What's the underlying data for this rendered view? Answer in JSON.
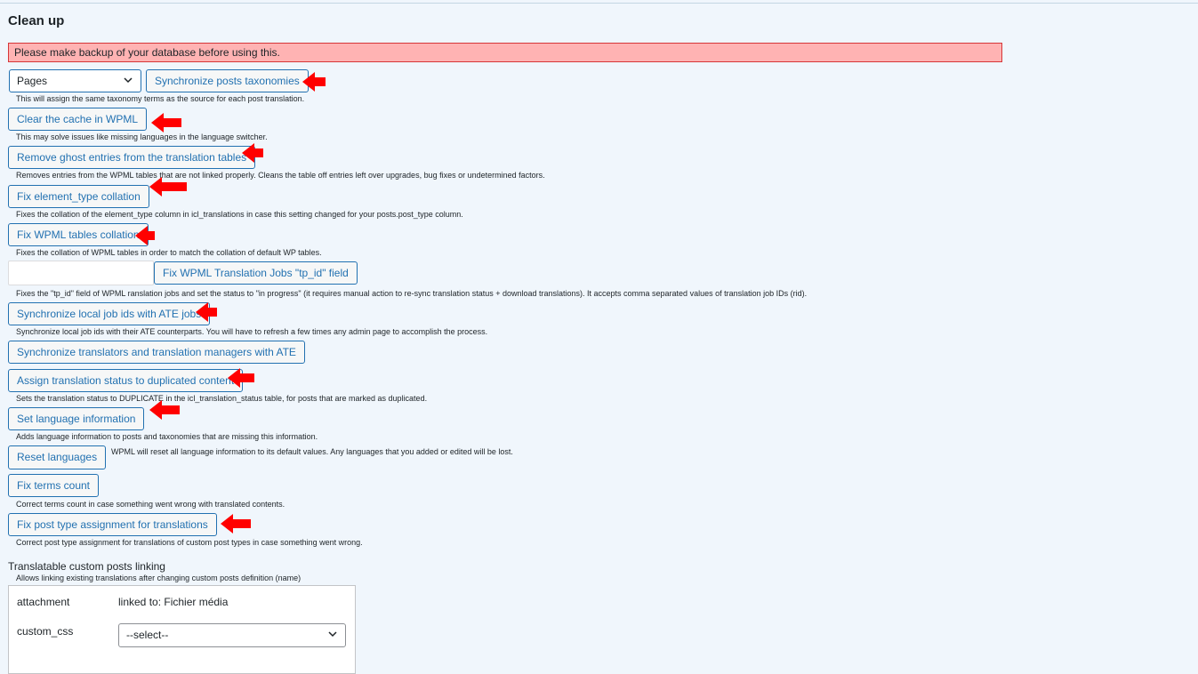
{
  "page": {
    "title": "Clean up",
    "warning": "Please make backup of your database before using this."
  },
  "sync_taxonomies": {
    "select_value": "Pages",
    "button": "Synchronize posts taxonomies",
    "desc": "This will assign the same taxonomy terms as the source for each post translation."
  },
  "clear_cache": {
    "button": "Clear the cache in WPML",
    "desc": "This may solve issues like missing languages in the language switcher."
  },
  "ghost_entries": {
    "button": "Remove ghost entries from the translation tables",
    "desc": "Removes entries from the WPML tables that are not linked properly. Cleans the table off entries left over upgrades, bug fixes or undetermined factors."
  },
  "element_type": {
    "button": "Fix element_type collation",
    "desc": "Fixes the collation of the element_type column in icl_translations in case this setting changed for your posts.post_type column."
  },
  "tables_collation": {
    "button": "Fix WPML tables collation",
    "desc": "Fixes the collation of WPML tables in order to match the collation of default WP tables."
  },
  "tp_id": {
    "input_value": "",
    "button": "Fix WPML Translation Jobs \"tp_id\" field",
    "desc": "Fixes the \"tp_id\" field of WPML ranslation jobs and set the status to \"in progress\" (it requires manual action to re-sync translation status + download translations). It accepts comma separated values of translation job IDs (rid)."
  },
  "ate_jobs": {
    "button": "Synchronize local job ids with ATE jobs",
    "desc": "Synchronize local job ids with their ATE counterparts. You will have to refresh a few times any admin page to accomplish the process."
  },
  "ate_translators": {
    "button": "Synchronize translators and translation managers with ATE"
  },
  "duplicated": {
    "button": "Assign translation status to duplicated content",
    "desc": "Sets the translation status to DUPLICATE in the icl_translation_status table, for posts that are marked as duplicated."
  },
  "language_info": {
    "button": "Set language information",
    "desc": "Adds language information to posts and taxonomies that are missing this information."
  },
  "reset_languages": {
    "button": "Reset languages",
    "desc": "WPML will reset all language information to its default values. Any languages that you added or edited will be lost."
  },
  "terms_count": {
    "button": "Fix terms count",
    "desc": "Correct terms count in case something went wrong with translated contents."
  },
  "post_type": {
    "button": "Fix post type assignment for translations",
    "desc": "Correct post type assignment for translations of custom post types in case something went wrong."
  },
  "custom_posts": {
    "title": "Translatable custom posts linking",
    "desc": "Allows linking existing translations after changing custom posts definition (name)",
    "rows": [
      {
        "name": "attachment",
        "value": "linked to: Fichier média"
      },
      {
        "name": "custom_css",
        "select": "--select--"
      }
    ]
  },
  "colors": {
    "background": "#f0f6fc",
    "button_text": "#2271b1",
    "warning_bg": "#ffb3b3",
    "arrow": "#ff0000"
  },
  "icons": [
    "chevron-down-icon",
    "red-arrow-icon"
  ]
}
